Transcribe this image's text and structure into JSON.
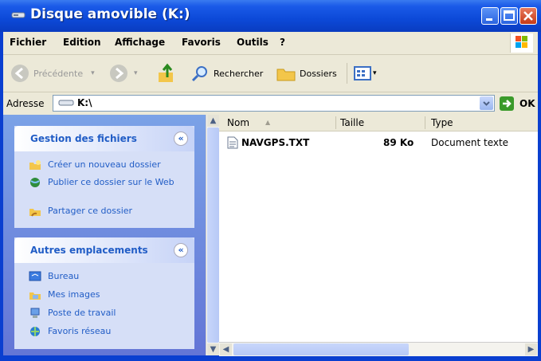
{
  "window": {
    "title": "Disque amovible (K:)"
  },
  "menu": {
    "items": [
      "Fichier",
      "Edition",
      "Affichage",
      "Favoris",
      "Outils",
      "?"
    ]
  },
  "toolbar": {
    "back_label": "Précédente",
    "search_label": "Rechercher",
    "folders_label": "Dossiers"
  },
  "address": {
    "label": "Adresse",
    "value": "K:\\",
    "go_label": "OK"
  },
  "tasks_panel": {
    "title": "Gestion des fichiers",
    "items": [
      "Créer un nouveau dossier",
      "Publier ce dossier sur le Web",
      "Partager ce dossier"
    ]
  },
  "places_panel": {
    "title": "Autres emplacements",
    "items": [
      "Bureau",
      "Mes images",
      "Poste de travail",
      "Favoris réseau"
    ]
  },
  "file_list": {
    "columns": [
      "Nom",
      "Taille",
      "Type"
    ],
    "rows": [
      {
        "name": "NAVGPS.TXT",
        "size": "89 Ko",
        "type": "Document texte"
      }
    ]
  },
  "colors": {
    "title_bar": "#0c49d8",
    "task_link": "#215dc6",
    "pane_bg": "#7ba2e7"
  }
}
